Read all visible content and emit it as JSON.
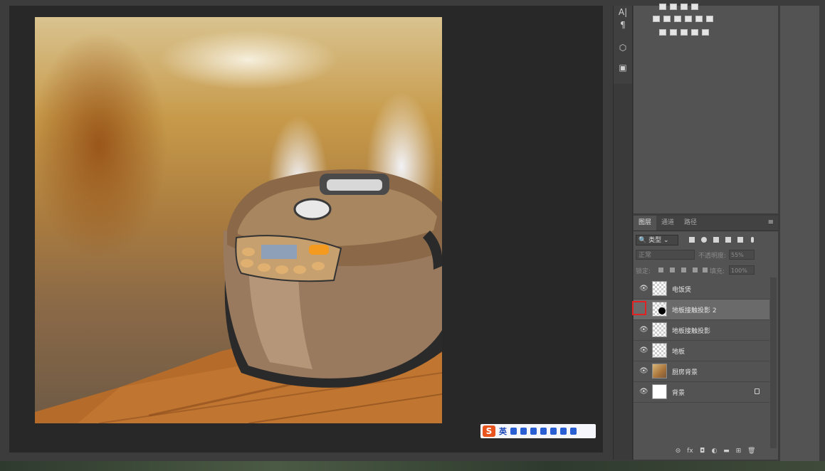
{
  "colors": {
    "accent_red": "#e22222",
    "panel_bg": "#535353",
    "selected_row": "#6a6a6a"
  },
  "tools": [
    {
      "icon": "character-panel-icon",
      "glyph": "A|"
    },
    {
      "icon": "paragraph-panel-icon",
      "glyph": "¶"
    },
    {
      "icon": "3d-cube-icon",
      "glyph": "⬡"
    },
    {
      "icon": "layer-comps-icon",
      "glyph": "▣"
    }
  ],
  "layers_panel": {
    "tabs": [
      "图层",
      "通道",
      "路径"
    ],
    "filter": "类型",
    "blend_mode": "正常",
    "opacity_label": "不透明度:",
    "opacity": "55%",
    "lock_label": "锁定:",
    "fill_label": "填充:",
    "fill": "100%",
    "layers": [
      {
        "name": "电饭煲",
        "visible": true,
        "thumb": "checker",
        "locked": false,
        "selected": false
      },
      {
        "name": "地板接触投影 2",
        "visible": false,
        "thumb": "checker",
        "locked": false,
        "selected": true
      },
      {
        "name": "地板接触投影",
        "visible": true,
        "thumb": "checker",
        "locked": false,
        "selected": false
      },
      {
        "name": "地板",
        "visible": true,
        "thumb": "checker",
        "locked": false,
        "selected": false
      },
      {
        "name": "厨房背景",
        "visible": true,
        "thumb": "kitchen",
        "locked": false,
        "selected": false
      },
      {
        "name": "背景",
        "visible": true,
        "thumb": "white",
        "locked": true,
        "selected": false
      }
    ]
  },
  "ime_bar": {
    "logo": "S",
    "lang": "英"
  },
  "footer_icons": [
    "link-layers-icon",
    "fx-icon",
    "add-mask-icon",
    "adjustment-layer-icon",
    "new-group-icon",
    "new-layer-icon",
    "delete-layer-icon"
  ]
}
